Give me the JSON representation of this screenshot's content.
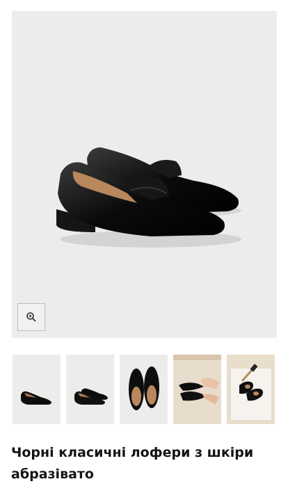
{
  "product": {
    "title": "Чорні класичні лофери з шкіри абразівато",
    "main_image": {
      "alt": "loafers-main-photo"
    },
    "zoom": {
      "icon": "zoom-in-icon"
    },
    "thumbnails": [
      {
        "alt": "thumbnail-side-view"
      },
      {
        "alt": "thumbnail-pair-side-view"
      },
      {
        "alt": "thumbnail-top-view"
      },
      {
        "alt": "thumbnail-hand-holding"
      },
      {
        "alt": "thumbnail-flatlay-brush"
      }
    ]
  },
  "colors": {
    "image_bg": "#ececeb",
    "shoe": "#0d0d0d",
    "lining": "#b8875c",
    "text": "#141414"
  }
}
